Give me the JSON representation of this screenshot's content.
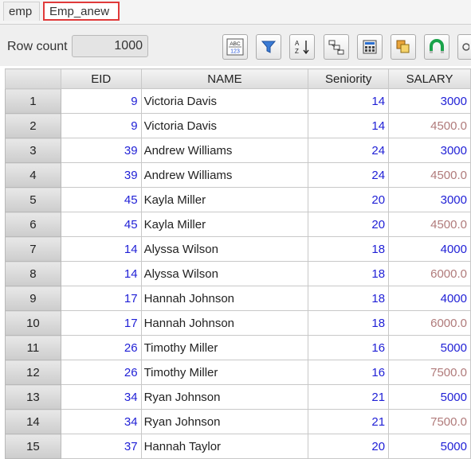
{
  "tabs": [
    {
      "label": "emp"
    },
    {
      "label": "Emp_anew"
    }
  ],
  "toolbar": {
    "row_count_label": "Row count",
    "row_count_value": "1000",
    "buttons": [
      {
        "icon": "abc-123-icon"
      },
      {
        "icon": "filter-icon"
      },
      {
        "icon": "sort-az-icon"
      },
      {
        "icon": "link-icon"
      },
      {
        "icon": "calculator-icon"
      },
      {
        "icon": "copy-icon"
      },
      {
        "icon": "magnet-icon"
      },
      {
        "icon": "more-icon"
      }
    ]
  },
  "grid": {
    "columns": [
      "EID",
      "NAME",
      "Seniority",
      "SALARY"
    ],
    "rows": [
      {
        "n": "1",
        "eid": "9",
        "name": "Victoria Davis",
        "seniority": "14",
        "salary": "3000"
      },
      {
        "n": "2",
        "eid": "9",
        "name": "Victoria Davis",
        "seniority": "14",
        "salary": "4500.0"
      },
      {
        "n": "3",
        "eid": "39",
        "name": "Andrew Williams",
        "seniority": "24",
        "salary": "3000"
      },
      {
        "n": "4",
        "eid": "39",
        "name": "Andrew Williams",
        "seniority": "24",
        "salary": "4500.0"
      },
      {
        "n": "5",
        "eid": "45",
        "name": "Kayla Miller",
        "seniority": "20",
        "salary": "3000"
      },
      {
        "n": "6",
        "eid": "45",
        "name": "Kayla Miller",
        "seniority": "20",
        "salary": "4500.0"
      },
      {
        "n": "7",
        "eid": "14",
        "name": "Alyssa Wilson",
        "seniority": "18",
        "salary": "4000"
      },
      {
        "n": "8",
        "eid": "14",
        "name": "Alyssa Wilson",
        "seniority": "18",
        "salary": "6000.0"
      },
      {
        "n": "9",
        "eid": "17",
        "name": "Hannah Johnson",
        "seniority": "18",
        "salary": "4000"
      },
      {
        "n": "10",
        "eid": "17",
        "name": "Hannah Johnson",
        "seniority": "18",
        "salary": "6000.0"
      },
      {
        "n": "11",
        "eid": "26",
        "name": "Timothy Miller",
        "seniority": "16",
        "salary": "5000"
      },
      {
        "n": "12",
        "eid": "26",
        "name": "Timothy Miller",
        "seniority": "16",
        "salary": "7500.0"
      },
      {
        "n": "13",
        "eid": "34",
        "name": "Ryan Johnson",
        "seniority": "21",
        "salary": "5000"
      },
      {
        "n": "14",
        "eid": "34",
        "name": "Ryan Johnson",
        "seniority": "21",
        "salary": "7500.0"
      },
      {
        "n": "15",
        "eid": "37",
        "name": "Hannah Taylor",
        "seniority": "20",
        "salary": "5000"
      }
    ]
  },
  "colors": {
    "integer_value": "#1f1fd6",
    "decimal_salary": "#b07a7a",
    "active_tab_border": "#e03a3a"
  }
}
